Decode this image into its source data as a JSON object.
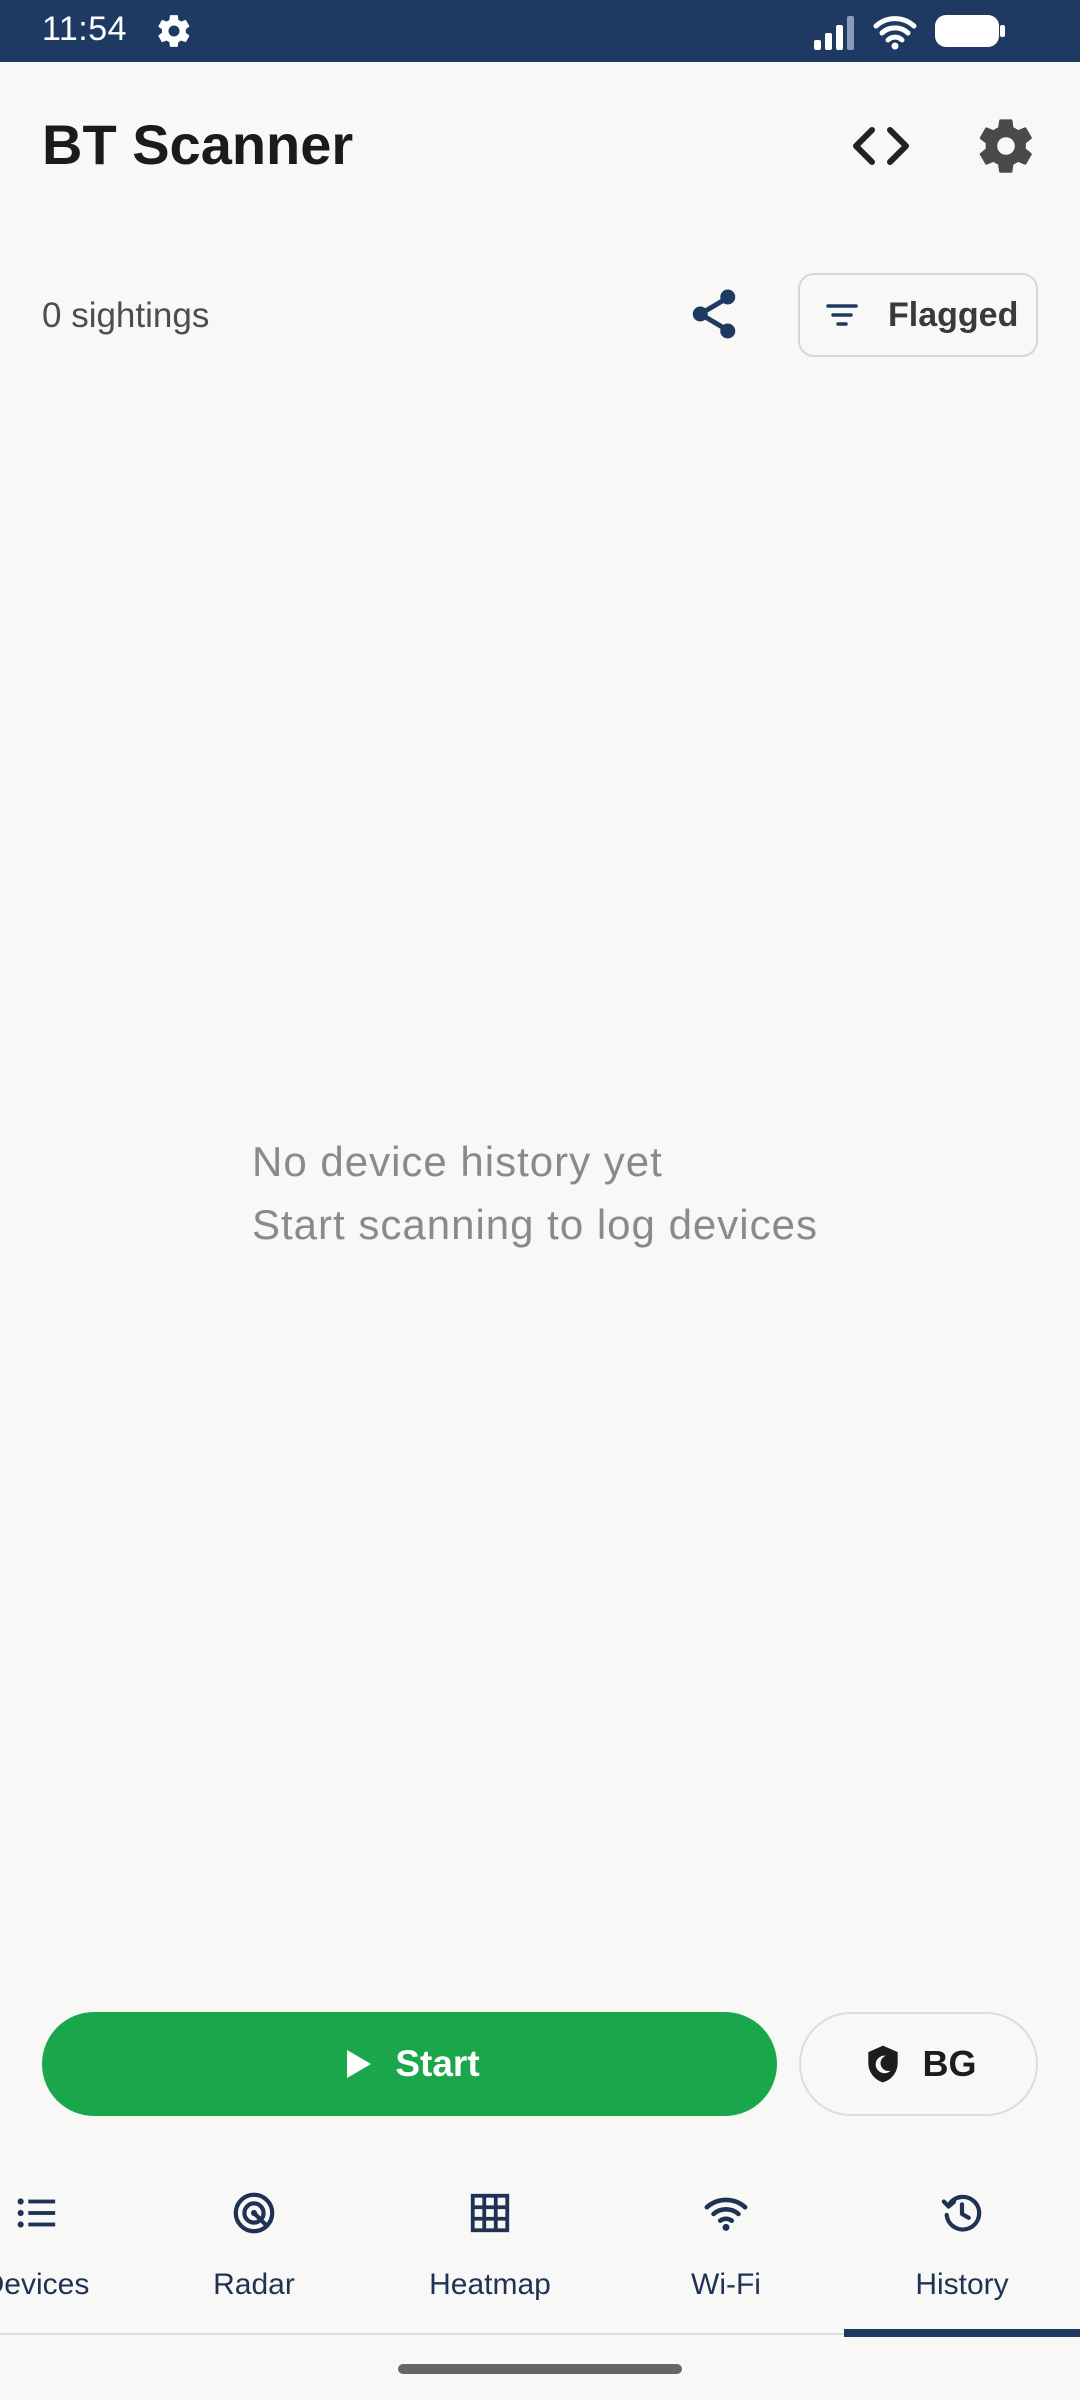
{
  "status_bar": {
    "time": "11:54",
    "icons": [
      "settings-icon",
      "signal-icon",
      "wifi-icon",
      "battery-icon"
    ]
  },
  "header": {
    "title": "BT Scanner",
    "actions": [
      "code-icon",
      "gear-icon"
    ]
  },
  "toolbar": {
    "sightings": "0 sightings",
    "share_icon": "share-icon",
    "filter_label": "Flagged"
  },
  "empty_state": {
    "line1": "No device history yet",
    "line2": "Start scanning to log devices"
  },
  "controls": {
    "start_label": "Start",
    "bg_label": "BG"
  },
  "bottom_nav": {
    "items": [
      {
        "label": "Devices",
        "icon": "list-icon"
      },
      {
        "label": "Radar",
        "icon": "radar-icon"
      },
      {
        "label": "Heatmap",
        "icon": "grid-icon"
      },
      {
        "label": "Wi-Fi",
        "icon": "wifi-icon"
      },
      {
        "label": "History",
        "icon": "history-icon"
      }
    ],
    "active": "History"
  },
  "colors": {
    "status_bar": "#1e3a63",
    "accent_green": "#1aa64b",
    "nav_text": "#1f3254",
    "background": "#f8f8f6"
  }
}
